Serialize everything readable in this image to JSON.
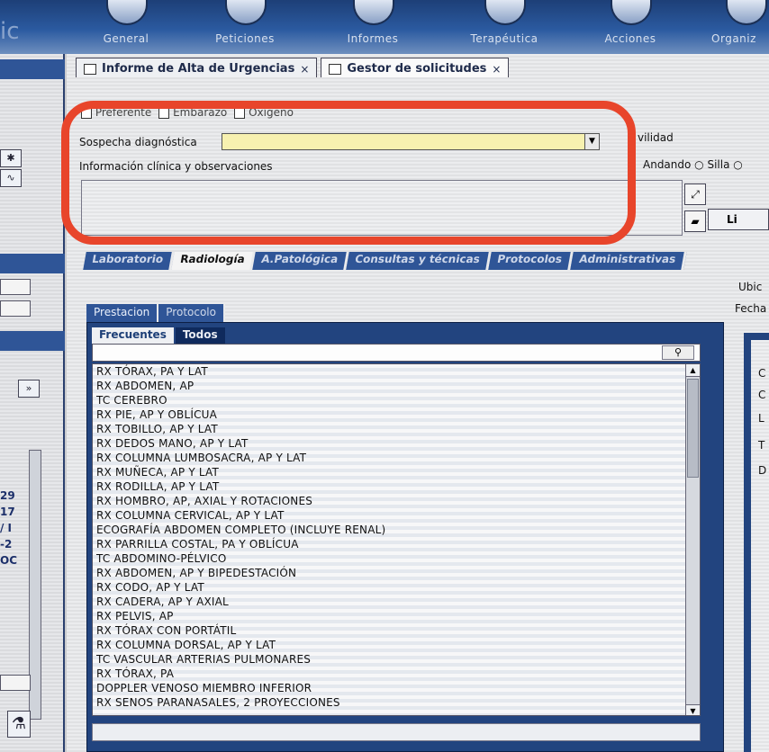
{
  "brand": "ic",
  "nav": [
    {
      "label": "General",
      "icon": "monitor-icon"
    },
    {
      "label": "Peticiones",
      "icon": "pen-icon"
    },
    {
      "label": "Informes",
      "icon": "report-icon"
    },
    {
      "label": "Terapéutica",
      "icon": "pill-icon"
    },
    {
      "label": "Acciones",
      "icon": "mail-icon"
    },
    {
      "label": "Organiz",
      "icon": "globe-icon"
    }
  ],
  "doc_tabs": [
    {
      "label": "Informe de Alta de Urgencias",
      "close": "×"
    },
    {
      "label": "Gestor de solicitudes",
      "close": "×"
    }
  ],
  "flags": [
    "Preferente",
    "Embarazo",
    "Oxígeno"
  ],
  "form": {
    "sospecha_label": "Sospecha diagnóstica",
    "sospecha_value": "",
    "info_label": "Información clínica y observaciones",
    "movilidad_label": "vilidad",
    "andando_label": "Andando",
    "silla_label": "Silla"
  },
  "side_button_label": "Li",
  "sections": [
    "Laboratorio",
    "Radiología",
    "A.Patológica",
    "Consultas y técnicas",
    "Protocolos",
    "Administrativas"
  ],
  "right_fields": {
    "ubic": "Ubic",
    "fecha": "Fecha"
  },
  "panel_tabs": [
    "Prestacion",
    "Protocolo"
  ],
  "inner_tabs": [
    "Frecuentes",
    "Todos"
  ],
  "search_value": "",
  "items": [
    "RX TÓRAX, PA Y LAT",
    "RX ABDOMEN, AP",
    "TC CEREBRO",
    "RX PIE, AP Y OBLÍCUA",
    "RX TOBILLO, AP Y LAT",
    "RX DEDOS MANO, AP Y LAT",
    "RX COLUMNA LUMBOSACRA, AP Y LAT",
    "RX MUÑECA, AP Y LAT",
    "RX RODILLA, AP Y LAT",
    "RX HOMBRO, AP, AXIAL Y ROTACIONES",
    "RX COLUMNA CERVICAL, AP Y LAT",
    "ECOGRAFÍA ABDOMEN COMPLETO (INCLUYE RENAL)",
    "RX PARRILLA COSTAL, PA Y OBLÍCUA",
    "TC ABDOMINO-PÉLVICO",
    "RX ABDOMEN, AP Y BIPEDESTACIÓN",
    "RX CODO, AP Y LAT",
    "RX CADERA, AP Y AXIAL",
    "RX PELVIS, AP",
    "RX TÓRAX CON PORTÁTIL",
    "RX COLUMNA DORSAL, AP Y LAT",
    "TC VASCULAR ARTERIAS PULMONARES",
    "RX TÓRAX, PA",
    "DOPPLER VENOSO MIEMBRO INFERIOR",
    "RX SENOS PARANASALES, 2 PROYECCIONES"
  ],
  "right_letters": [
    "C",
    "C",
    "L",
    "T",
    "D"
  ],
  "left_numbers": [
    "29",
    "17",
    "/ I",
    "-2",
    "OC"
  ],
  "highlight_color": "#e8452b",
  "accent_color": "#2f5597"
}
